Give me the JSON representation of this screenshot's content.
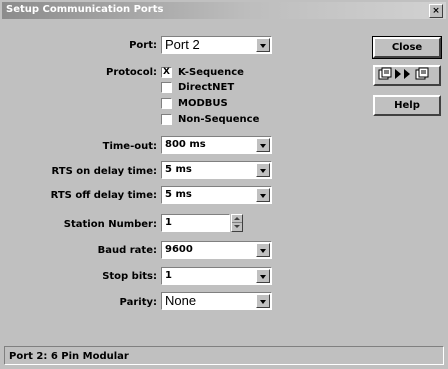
{
  "window": {
    "title": "Setup Communication Ports"
  },
  "port": {
    "label": "Port:",
    "value": "Port 2"
  },
  "protocol": {
    "label": "Protocol:",
    "options": [
      {
        "label": "K-Sequence",
        "checked": true,
        "mark": "X"
      },
      {
        "label": "DirectNET",
        "checked": false,
        "mark": ""
      },
      {
        "label": "MODBUS",
        "checked": false,
        "mark": ""
      },
      {
        "label": "Non-Sequence",
        "checked": false,
        "mark": ""
      }
    ]
  },
  "timeout": {
    "label": "Time-out:",
    "value": "800 ms"
  },
  "rts_on": {
    "label": "RTS on delay time:",
    "value": "5 ms"
  },
  "rts_off": {
    "label": "RTS off delay time:",
    "value": "5 ms"
  },
  "station": {
    "label": "Station Number:",
    "value": "1"
  },
  "baud": {
    "label": "Baud rate:",
    "value": "9600"
  },
  "stop_bits": {
    "label": "Stop bits:",
    "value": "1"
  },
  "parity": {
    "label": "Parity:",
    "value": "None"
  },
  "buttons": {
    "close": "Close",
    "help": "Help"
  },
  "status": {
    "text": "Port 2: 6 Pin Modular"
  }
}
